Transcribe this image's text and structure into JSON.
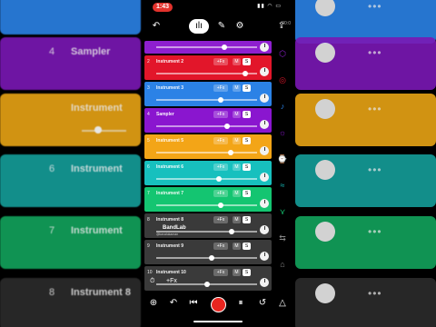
{
  "status": {
    "time": "1:43",
    "icons": "▮▮ ◠ ▭"
  },
  "toolbar": {
    "back": "↶",
    "waveform": "ılı",
    "pen": "✎",
    "settings": "⚙",
    "upload": "⇪",
    "timer": "00:0"
  },
  "tracks": [
    {
      "num": "",
      "name": "",
      "color": "#8e1fcf",
      "thumb": 0.68
    },
    {
      "num": "2",
      "name": "Instrument 2",
      "color": "#e2162a",
      "thumb": 0.88,
      "fx": "+Fx",
      "m": "M",
      "s": "S"
    },
    {
      "num": "3",
      "name": "Instrument 3",
      "color": "#2b82e6",
      "thumb": 0.64,
      "fx": "+Fx",
      "m": "M",
      "s": "S"
    },
    {
      "num": "4",
      "name": "Sampler",
      "color": "#8a16cf",
      "thumb": 0.7,
      "fx": "+Fx",
      "m": "M",
      "s": "S"
    },
    {
      "num": "5",
      "name": "Instrument 5",
      "color": "#f3a517",
      "thumb": 0.74,
      "fx": "+Fx",
      "m": "M",
      "s": "S"
    },
    {
      "num": "6",
      "name": "Instrument 6",
      "color": "#17c0be",
      "thumb": 0.62,
      "fx": "+Fx",
      "m": "M",
      "s": "S"
    },
    {
      "num": "7",
      "name": "Instrument 7",
      "color": "#14c571",
      "thumb": 0.64,
      "fx": "+Fx",
      "m": "M",
      "s": "S"
    },
    {
      "num": "8",
      "name": "Instrument 8",
      "color": "#3a3a3a",
      "thumb": 0.75,
      "fx": "+Fx",
      "m": "M",
      "s": "S"
    },
    {
      "num": "9",
      "name": "Instrument 9",
      "color": "#3a3a3a",
      "thumb": 0.55,
      "fx": "+Fx",
      "m": "M",
      "s": "S"
    },
    {
      "num": "10",
      "name": "Instrument 10",
      "color": "#3a3a3a",
      "thumb": 0.5,
      "fx": "+Fx",
      "m": "M",
      "s": "S"
    }
  ],
  "watermark": {
    "brand": "BandLab",
    "handle": "@kavalukaman"
  },
  "add_row": {
    "metronome": "⏱",
    "fx": "+Fx"
  },
  "transport": {
    "undo": "↶",
    "skip_back": "⏮",
    "pause": "⏸",
    "loop": "↺",
    "metronome": "△"
  },
  "side_icons": [
    "⬡",
    "◎",
    "♪",
    "☼",
    "⌚",
    "≈",
    "⋎",
    "⇆",
    "⌂"
  ],
  "bg_tracks": [
    {
      "num": "4",
      "name": "Sampler",
      "color": "#7a18b5"
    },
    {
      "num": "",
      "name": "Instrument",
      "color": "#e8a315"
    },
    {
      "num": "6",
      "name": "Instrument",
      "color": "#149e9a"
    },
    {
      "num": "7",
      "name": "Instrument",
      "color": "#12a45c"
    },
    {
      "num": "8",
      "name": "Instrument 8",
      "color": "#2c2c2c"
    }
  ]
}
